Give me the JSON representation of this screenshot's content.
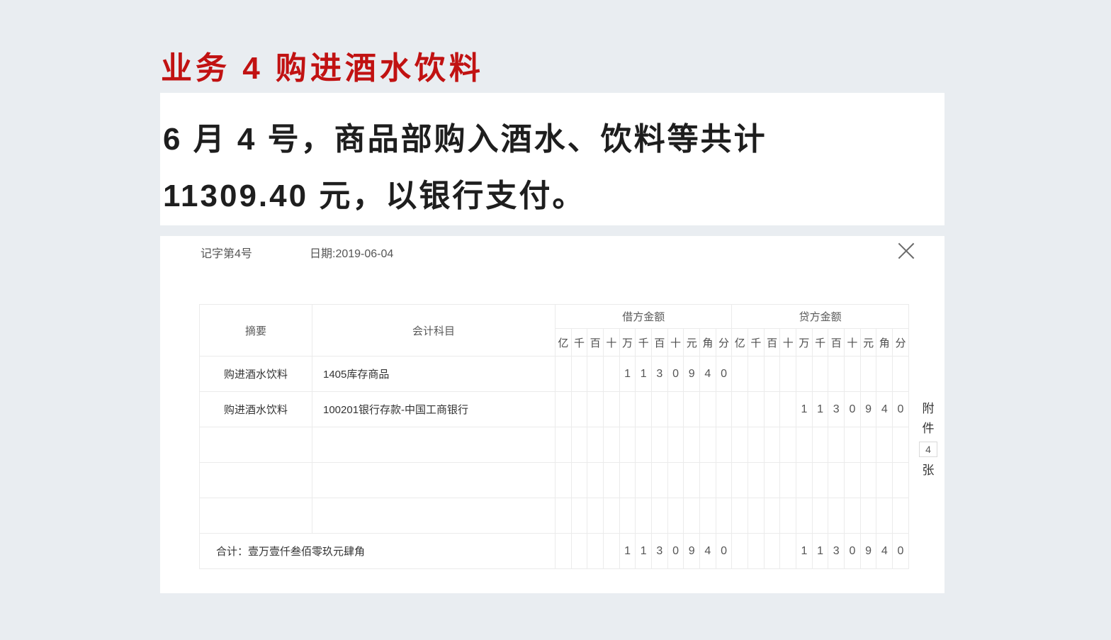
{
  "page": {
    "title": "业务 4 购进酒水饮料",
    "description_lines": [
      "6 月 4 号，商品部购入酒水、饮料等共计",
      "11309.40 元，以银行支付。"
    ]
  },
  "voucher": {
    "voucher_no": "记字第4号",
    "date_label": "日期:2019-06-04",
    "table": {
      "summary_header": "摘要",
      "account_header": "会计科目",
      "debit_header": "借方金额",
      "credit_header": "贷方金额",
      "digit_units": [
        "亿",
        "千",
        "百",
        "十",
        "万",
        "千",
        "百",
        "十",
        "元",
        "角",
        "分"
      ],
      "rows": [
        {
          "summary": "购进酒水饮料",
          "account": "1405库存商品",
          "debit": [
            "",
            "",
            "",
            "",
            "1",
            "1",
            "3",
            "0",
            "9",
            "4",
            "0"
          ],
          "credit": [
            "",
            "",
            "",
            "",
            "",
            "",
            "",
            "",
            "",
            "",
            ""
          ]
        },
        {
          "summary": "购进酒水饮料",
          "account": "100201银行存款-中国工商银行",
          "debit": [
            "",
            "",
            "",
            "",
            "",
            "",
            "",
            "",
            "",
            "",
            ""
          ],
          "credit": [
            "",
            "",
            "",
            "",
            "1",
            "1",
            "3",
            "0",
            "9",
            "4",
            "0"
          ]
        },
        {
          "summary": "",
          "account": "",
          "debit": [
            "",
            "",
            "",
            "",
            "",
            "",
            "",
            "",
            "",
            "",
            ""
          ],
          "credit": [
            "",
            "",
            "",
            "",
            "",
            "",
            "",
            "",
            "",
            "",
            ""
          ]
        },
        {
          "summary": "",
          "account": "",
          "debit": [
            "",
            "",
            "",
            "",
            "",
            "",
            "",
            "",
            "",
            "",
            ""
          ],
          "credit": [
            "",
            "",
            "",
            "",
            "",
            "",
            "",
            "",
            "",
            "",
            ""
          ]
        },
        {
          "summary": "",
          "account": "",
          "debit": [
            "",
            "",
            "",
            "",
            "",
            "",
            "",
            "",
            "",
            "",
            ""
          ],
          "credit": [
            "",
            "",
            "",
            "",
            "",
            "",
            "",
            "",
            "",
            "",
            ""
          ]
        },
        {
          "total": true,
          "summary": "合计：壹万壹仟叁佰零玖元肆角",
          "debit": [
            "",
            "",
            "",
            "",
            "1",
            "1",
            "3",
            "0",
            "9",
            "4",
            "0"
          ],
          "credit": [
            "",
            "",
            "",
            "",
            "1",
            "1",
            "3",
            "0",
            "9",
            "4",
            "0"
          ]
        }
      ]
    },
    "attachment": {
      "label_line1": "附",
      "label_line2": "件",
      "count": "4",
      "unit": "张"
    }
  },
  "icons": {
    "close": "✕"
  },
  "colors": {
    "page_background": "#e9edf1",
    "accent_red": "#c11212",
    "grid_gray": "#ebebeb",
    "grid_separator_blue": "#a9d4f2",
    "grid_separator_red": "#f0bcbc"
  }
}
